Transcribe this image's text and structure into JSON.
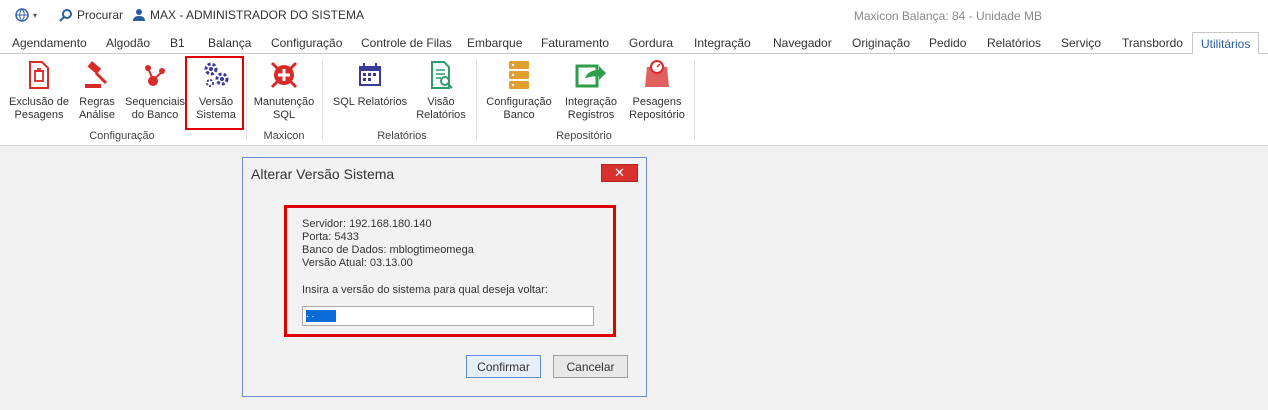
{
  "titlebar": {
    "search_label": "Procurar",
    "user_label": "MAX - ADMINISTRADOR DO SISTEMA",
    "context": "Maxicon Balança: 84 - Unidade MB"
  },
  "tabs": [
    "Agendamento",
    "Algodão",
    "B1",
    "Balança",
    "Configuração",
    "Controle de Filas",
    "Embarque",
    "Faturamento",
    "Gordura",
    "Integração",
    "Navegador",
    "Originação",
    "Pedido",
    "Relatórios",
    "Serviço",
    "Transbordo",
    "Utilitários"
  ],
  "active_tab": "Utilitários",
  "ribbon": {
    "buttons": [
      {
        "l1": "Exclusão de",
        "l2": "Pesagens",
        "icon": "trash-icon"
      },
      {
        "l1": "Regras",
        "l2": "Análise",
        "icon": "gavel-icon"
      },
      {
        "l1": "Sequenciais",
        "l2": "do Banco",
        "icon": "sequence-icon"
      },
      {
        "l1": "Versão",
        "l2": "Sistema",
        "icon": "gears-icon"
      },
      {
        "l1": "Manutenção",
        "l2": "SQL",
        "icon": "maintenance-icon"
      },
      {
        "l1": "SQL Relatórios",
        "l2": "",
        "icon": "calendar-icon"
      },
      {
        "l1": "Visão",
        "l2": "Relatórios",
        "icon": "report-search-icon"
      },
      {
        "l1": "Configuração",
        "l2": "Banco",
        "icon": "database-icon"
      },
      {
        "l1": "Integração",
        "l2": "Registros",
        "icon": "export-icon"
      },
      {
        "l1": "Pesagens",
        "l2": "Repositório",
        "icon": "scale-icon"
      }
    ],
    "groups": [
      "Configuração",
      "Maxicon",
      "Relatórios",
      "Repositório"
    ]
  },
  "dialog": {
    "title": "Alterar Versão Sistema",
    "close": "✕",
    "servidor": "Servidor: 192.168.180.140",
    "porta": "Porta: 5433",
    "banco": "Banco de Dados: mblogtimeomega",
    "versao": "Versão Atual: 03.13.00",
    "prompt": "Insira a versão do sistema para qual deseja voltar:",
    "input_value": "  .  .  ",
    "confirm": "Confirmar",
    "cancel": "Cancelar"
  },
  "colors": {
    "accent": "#2a5d9f",
    "highlight": "#e00000",
    "close": "#d9322e"
  }
}
